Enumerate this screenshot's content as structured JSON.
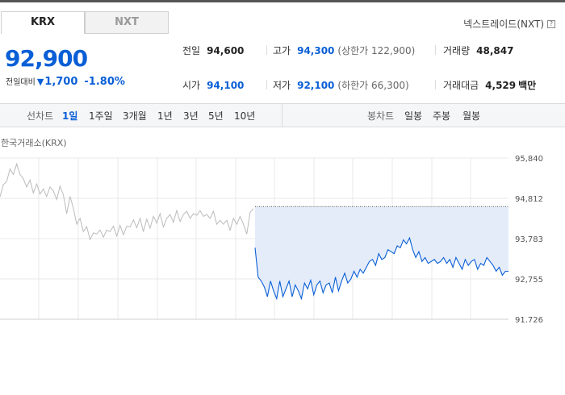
{
  "tabs": {
    "krx": "KRX",
    "nxt": "NXT"
  },
  "nextrade_link": "넥스트레이드(NXT)",
  "help_glyph": "?",
  "price": "92,900",
  "change": {
    "label": "전일대비",
    "arrow": "▼",
    "amount": "1,700",
    "percent": "-1.80%"
  },
  "summary": {
    "prev_close": {
      "label": "전일",
      "value": "94,600"
    },
    "high": {
      "label": "고가",
      "value": "94,300",
      "sub": "(상한가 122,900)"
    },
    "volume": {
      "label": "거래량",
      "value": "48,847"
    },
    "open": {
      "label": "시가",
      "value": "94,100"
    },
    "low": {
      "label": "저가",
      "value": "92,100",
      "sub": "(하한가 66,300)"
    },
    "amount": {
      "label": "거래대금",
      "value": "4,529",
      "unit": "백만"
    }
  },
  "period_bar": {
    "line_chart_label": "선차트",
    "line_periods": [
      "1일",
      "1주일",
      "3개월",
      "1년",
      "3년",
      "5년",
      "10년"
    ],
    "active_period": "1일",
    "candle_chart_label": "봉차트",
    "candle_periods": [
      "일봉",
      "주봉",
      "월봉"
    ]
  },
  "colors": {
    "accent": "#0a5fd6",
    "down": "#0a5fd6",
    "prev_line": "#bbbbbb",
    "fill": "#e4ecfa"
  },
  "chart_data": {
    "type": "line",
    "title": "한국거래소(KRX)",
    "y_ticks": [
      "95,840",
      "94,812",
      "93,783",
      "92,755",
      "91,726"
    ],
    "ylim": [
      91726,
      95840
    ],
    "reference_line": 94600,
    "series": [
      {
        "values": [
          94850,
          95160,
          95240,
          95560,
          95420,
          95690,
          95420,
          95310,
          95100,
          95280,
          94950,
          95180,
          94920,
          95050,
          94860,
          95100,
          95000,
          94780,
          95120,
          94900,
          94420,
          94860,
          94560,
          94150,
          94300,
          93960,
          94090,
          93760,
          93930,
          93900,
          94000,
          93820,
          94000,
          93960,
          94100,
          93850,
          94120,
          93880,
          94100,
          94080,
          94260,
          94060,
          94300,
          93960,
          94280,
          94050,
          94350,
          94180,
          94420,
          94080,
          94300,
          94400,
          94200,
          94500,
          94220,
          94400,
          94480,
          94300,
          94420,
          94380,
          94500,
          94350,
          94400,
          94300,
          94480,
          94150,
          94250,
          94150,
          94250,
          94000,
          94300,
          94150,
          94350,
          94150,
          93900,
          94450,
          94550
        ]
      },
      {
        "values": [
          93550,
          92800,
          92700,
          92550,
          92300,
          92700,
          92450,
          92250,
          92700,
          92300,
          92500,
          92700,
          92300,
          92600,
          92450,
          92250,
          92650,
          92500,
          92720,
          92350,
          92600,
          92700,
          92400,
          92600,
          92650,
          92400,
          92800,
          92450,
          92700,
          92900,
          92650,
          92750,
          92950,
          92800,
          93000,
          92900,
          93050,
          93200,
          93250,
          93100,
          93400,
          93250,
          93300,
          93500,
          93450,
          93400,
          93600,
          93550,
          93750,
          93650,
          93800,
          93500,
          93300,
          93450,
          93200,
          93300,
          93150,
          93200,
          93250,
          93150,
          93200,
          93300,
          93150,
          93250,
          93050,
          93300,
          93150,
          93000,
          93250,
          93100,
          93200,
          93250,
          93000,
          93150,
          93100,
          93300,
          93200,
          93100,
          92950,
          93050,
          92850,
          92950,
          92950
        ]
      }
    ]
  }
}
